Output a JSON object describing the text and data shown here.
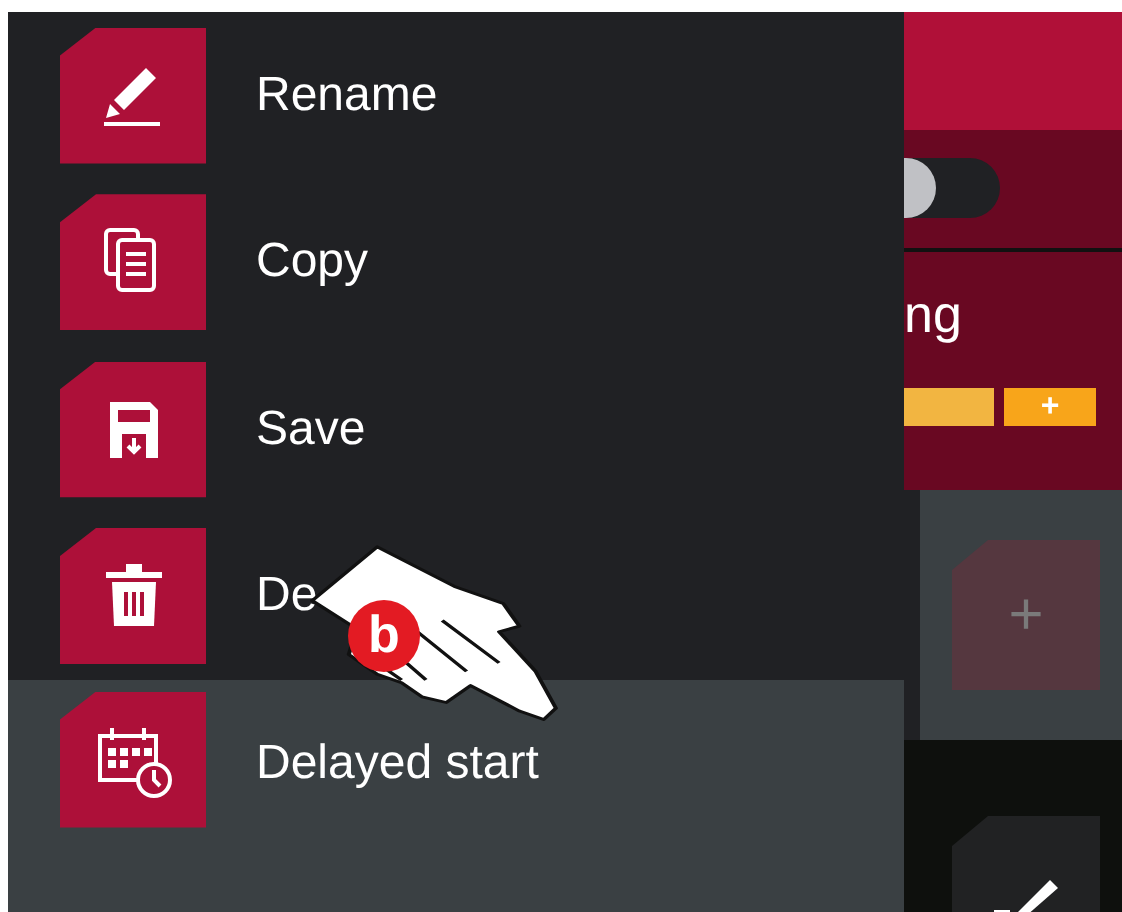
{
  "menu": {
    "items": [
      {
        "kind": "pencil",
        "label": "Rename",
        "selected": false
      },
      {
        "kind": "copy",
        "label": "Copy",
        "selected": false
      },
      {
        "kind": "save",
        "label": "Save",
        "selected": false
      },
      {
        "kind": "trash",
        "label": "De",
        "selected": false
      },
      {
        "kind": "calendar",
        "label": "Delayed start",
        "selected": true
      }
    ]
  },
  "background": {
    "toggle": {
      "on": false
    },
    "title": "ng",
    "add_button": "+",
    "tile_add": "+"
  },
  "pointer": {
    "badge": "b"
  }
}
